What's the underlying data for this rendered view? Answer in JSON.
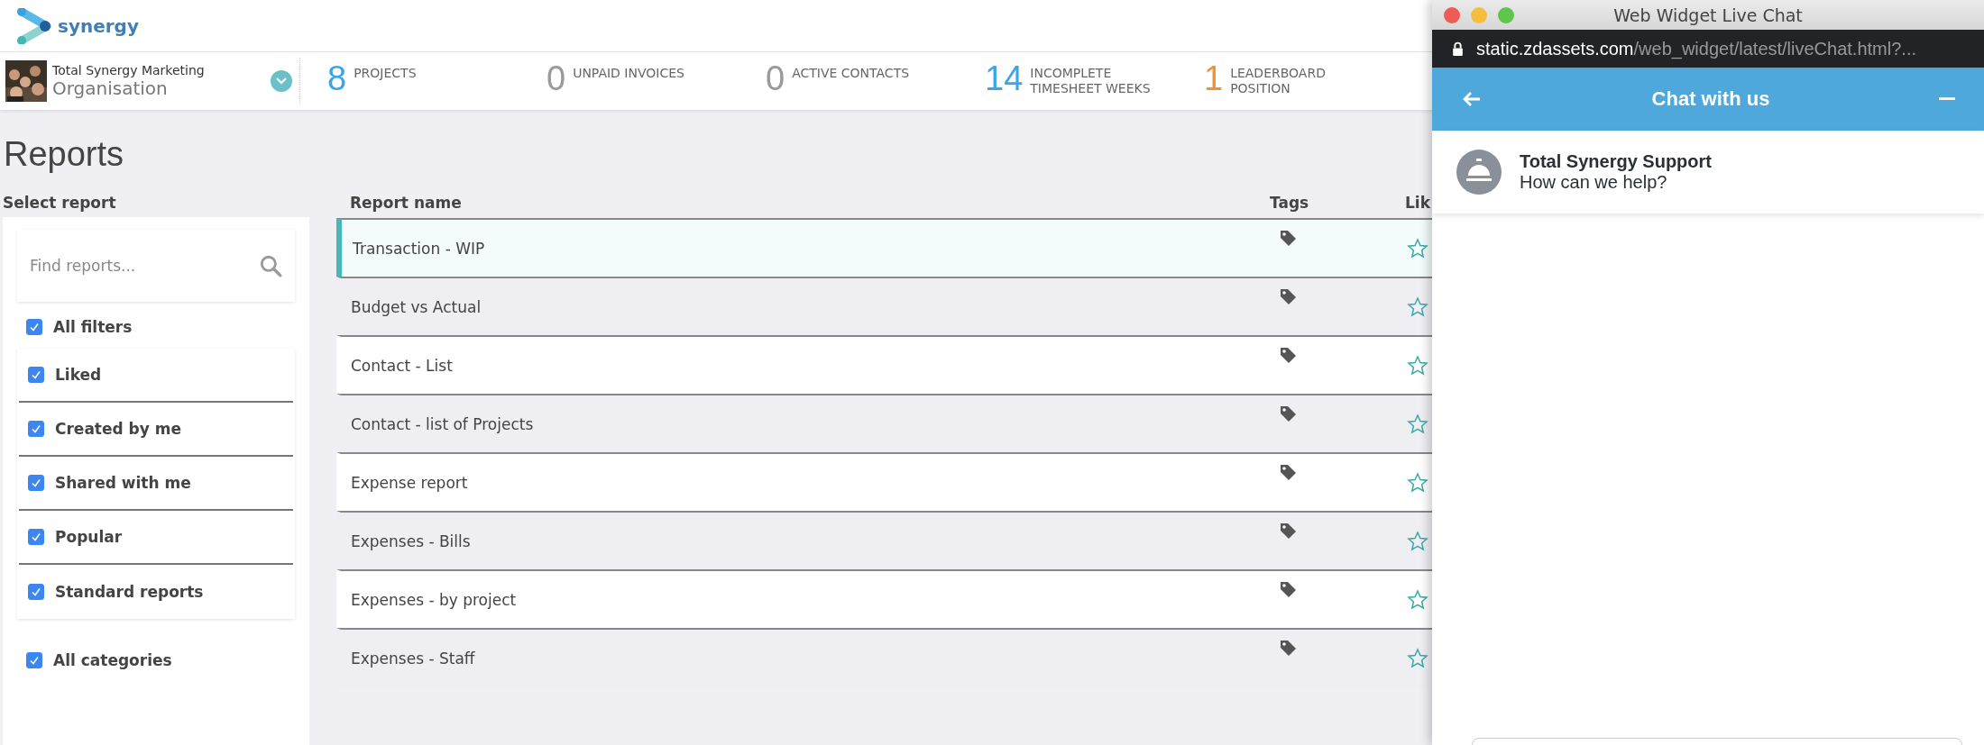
{
  "app": {
    "logo_text": "synergy"
  },
  "organisation": {
    "company": "Total Synergy Marketing",
    "name": "Organisation"
  },
  "stats": [
    {
      "value": "8",
      "label": "PROJECTS",
      "color": "#3aa6e8"
    },
    {
      "value": "0",
      "label": "UNPAID INVOICES",
      "color": "#9a9a9a"
    },
    {
      "value": "0",
      "label": "ACTIVE CONTACTS",
      "color": "#9a9a9a"
    },
    {
      "value": "14",
      "label": "INCOMPLETE TIMESHEET WEEKS",
      "color": "#3aa6e8"
    },
    {
      "value": "1",
      "label": "LEADERBOARD POSITION",
      "color": "#f0913a"
    }
  ],
  "page_title": "Reports",
  "sidebar": {
    "title": "Select report",
    "search": {
      "placeholder": "Find reports..."
    },
    "all_filters": {
      "label": "All filters",
      "checked": true
    },
    "filters": [
      {
        "label": "Liked",
        "checked": true
      },
      {
        "label": "Created by me",
        "checked": true
      },
      {
        "label": "Shared with me",
        "checked": true
      },
      {
        "label": "Popular",
        "checked": true
      },
      {
        "label": "Standard reports",
        "checked": true
      }
    ],
    "all_categories": {
      "label": "All categories",
      "checked": true
    }
  },
  "table": {
    "columns": [
      "Report name",
      "Tags",
      "Lik"
    ],
    "rows": [
      {
        "name": "Transaction - WIP",
        "selected": true,
        "liked": false
      },
      {
        "name": "Budget vs Actual",
        "selected": false,
        "liked": false
      },
      {
        "name": "Contact - List",
        "selected": false,
        "liked": false
      },
      {
        "name": "Contact - list of Projects",
        "selected": false,
        "liked": false
      },
      {
        "name": "Expense report",
        "selected": false,
        "liked": false
      },
      {
        "name": "Expenses - Bills",
        "selected": false,
        "liked": false
      },
      {
        "name": "Expenses - by project",
        "selected": false,
        "liked": false
      },
      {
        "name": "Expenses - Staff",
        "selected": false,
        "liked": false
      }
    ]
  },
  "chat_window": {
    "title": "Web Widget Live Chat",
    "url_host": "static.zdassets.com",
    "url_path": "/web_widget/latest/liveChat.html?...",
    "header": "Chat with us",
    "agent_name": "Total Synergy Support",
    "agent_message": "How can we help?"
  }
}
